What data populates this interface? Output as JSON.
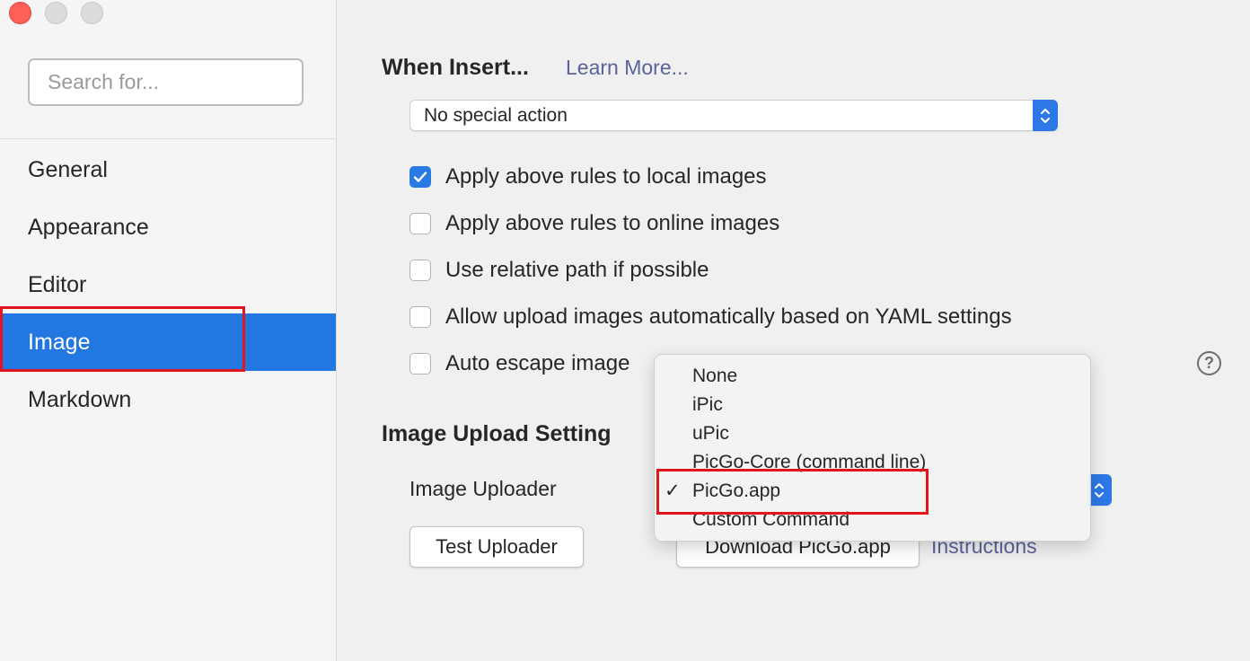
{
  "window": {
    "traffic_lights": [
      "close",
      "minimize",
      "maximize"
    ]
  },
  "sidebar": {
    "search_placeholder": "Search for...",
    "items": [
      {
        "label": "General"
      },
      {
        "label": "Appearance"
      },
      {
        "label": "Editor"
      },
      {
        "label": "Image",
        "active": true
      },
      {
        "label": "Markdown"
      }
    ]
  },
  "main": {
    "when_insert": {
      "title": "When Insert...",
      "learn_more": "Learn More...",
      "select_value": "No special action"
    },
    "checkboxes": [
      {
        "label": "Apply above rules to local images",
        "checked": true
      },
      {
        "label": "Apply above rules to online images",
        "checked": false
      },
      {
        "label": "Use relative path if possible",
        "checked": false
      },
      {
        "label": "Allow upload images automatically based on YAML settings",
        "checked": false
      },
      {
        "label": "Auto escape image",
        "checked": false
      }
    ],
    "help_icon": "?",
    "upload": {
      "title": "Image Upload Setting",
      "uploader_label": "Image Uploader",
      "test_button": "Test Uploader",
      "download_button": "Download PicGo.app",
      "instructions_link": "Instructions"
    }
  },
  "dropdown": {
    "options": [
      "None",
      "iPic",
      "uPic",
      "PicGo-Core (command line)",
      "PicGo.app",
      "Custom Command"
    ],
    "selected": "PicGo.app",
    "check_glyph": "✓"
  },
  "colors": {
    "accent": "#2277e0",
    "highlight_box": "#e0161c",
    "link": "#5a6399"
  }
}
